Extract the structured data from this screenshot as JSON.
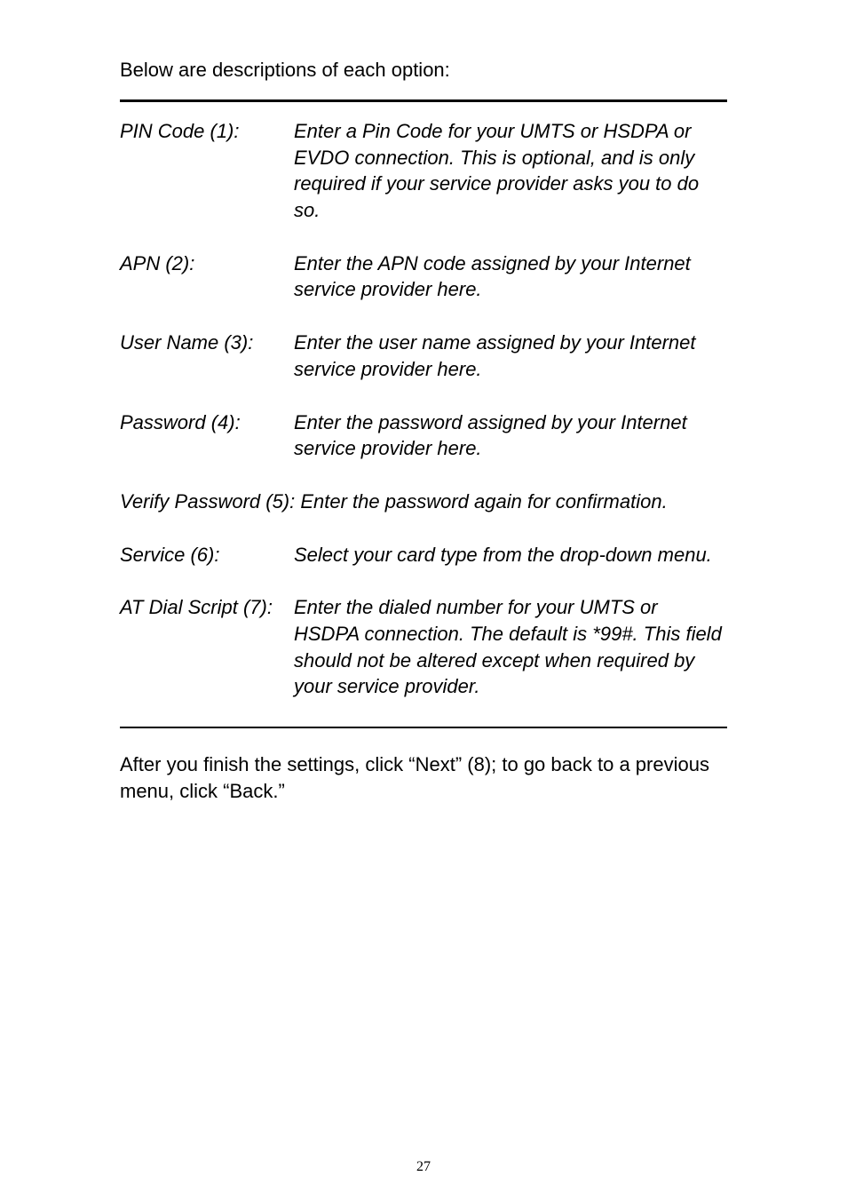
{
  "intro": "Below are descriptions of each option:",
  "items": [
    {
      "label": "PIN Code (1):",
      "desc": "Enter a Pin Code for your UMTS or HSDPA or EVDO connection. This is optional, and is only required if your service provider asks you to do so."
    },
    {
      "label": "APN (2):",
      "desc": "Enter the APN code assigned by your Internet service provider here."
    },
    {
      "label": "User Name (3):",
      "desc": "Enter the user name assigned by your Internet service provider here."
    },
    {
      "label": "Password (4):",
      "desc": "Enter the password assigned by your Internet service provider here."
    }
  ],
  "full_item": "Verify Password (5): Enter the password again for confirmation.",
  "items2": [
    {
      "label": "Service (6):",
      "desc": "Select your card type from the drop-down menu."
    },
    {
      "label": "AT Dial Script (7):",
      "desc": "Enter the dialed number for your UMTS or HSDPA connection. The default is *99#. This field should not be altered except when required by your service provider."
    }
  ],
  "outro": "After you finish the settings, click “Next” (8); to go back to a previous menu, click “Back.”",
  "page_number": "27"
}
